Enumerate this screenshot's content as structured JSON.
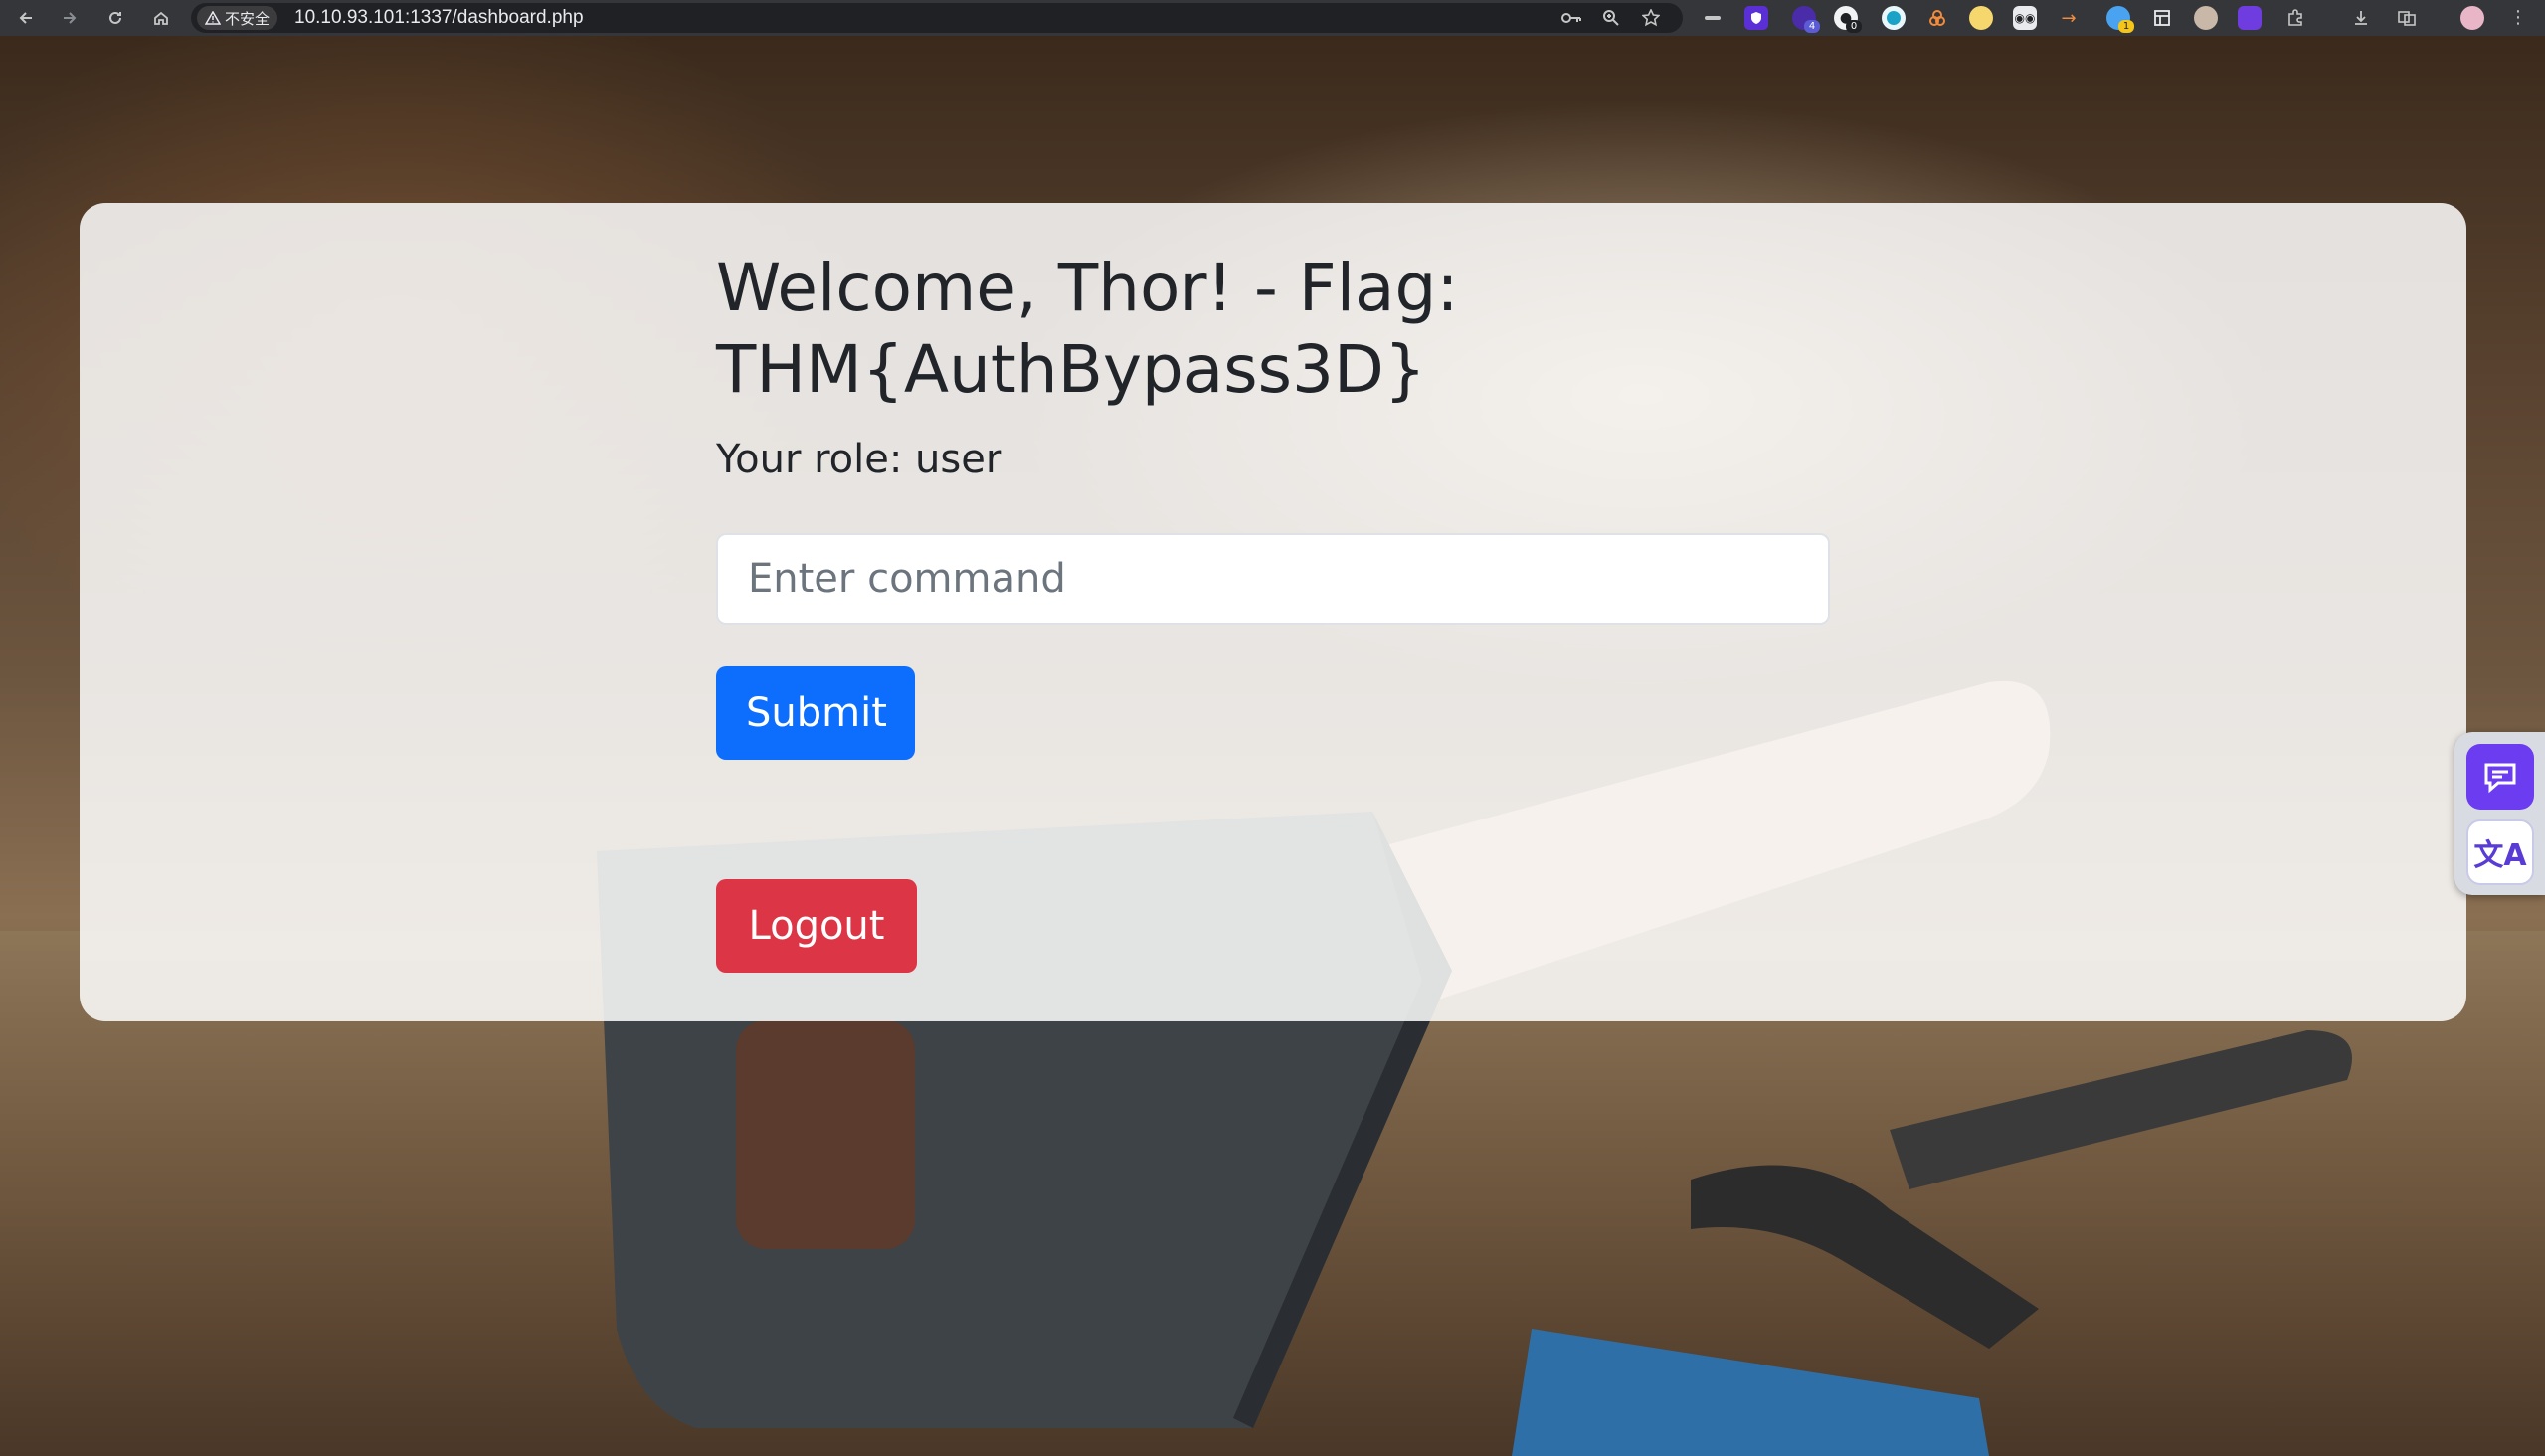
{
  "browser": {
    "security_label": "不安全",
    "url": "10.10.93.101:1337/dashboard.php",
    "extension_badges": {
      "ext_a": "4",
      "ext_b": "0",
      "ext_c": "1"
    }
  },
  "page": {
    "welcome_line1": "Welcome, Thor! - Flag:",
    "welcome_line2": "THM{AuthBypass3D}",
    "role_text": "Your role: user",
    "command_input": {
      "placeholder": "Enter command",
      "value": ""
    },
    "submit_label": "Submit",
    "logout_label": "Logout"
  },
  "colors": {
    "primary_button": "#0d6efd",
    "danger_button": "#dc3545",
    "card_background": "rgba(255,255,255,0.85)",
    "chat_widget": "#6c3cf0"
  },
  "icons": {
    "side_widget": [
      "chat-icon",
      "translate-icon"
    ]
  }
}
